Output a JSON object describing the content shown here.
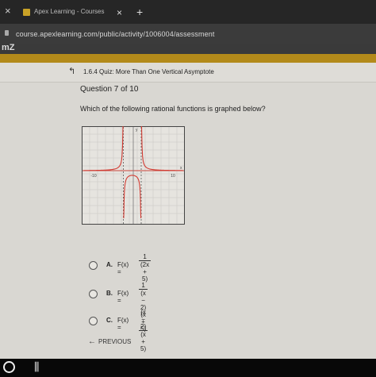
{
  "browser": {
    "tab_title": "Apex Learning - Courses",
    "tab_close": "×",
    "new_tab": "+",
    "window_close": "×",
    "url": "course.apexlearning.com/public/activity/1006004/assessment"
  },
  "quiz": {
    "back_icon": "↰",
    "title": "1.6.4 Quiz: More Than One Vertical Asymptote",
    "question_label": "Question 7 of 10",
    "question_text": "Which of the following rational functions is graphed below?"
  },
  "graph": {
    "x_min_label": "-10",
    "x_max_label": "10",
    "y_axis_label": "y",
    "x_axis_label": "x",
    "asymptotes_x": [
      -2.5,
      2
    ],
    "axis_color": "#c9463c",
    "curve_color": "#d23b32"
  },
  "choices": [
    {
      "letter": "A.",
      "lhs": "F(x) =",
      "num": "1",
      "den": "(2x + 5)"
    },
    {
      "letter": "B.",
      "lhs": "F(x) =",
      "num": "1",
      "den": "(x − 2)(x + 5)"
    },
    {
      "letter": "C.",
      "lhs": "F(x) =",
      "num": "(x − 2)",
      "den": "(x + 5)"
    }
  ],
  "nav": {
    "previous_label": "PREVIOUS",
    "previous_icon": "←"
  }
}
